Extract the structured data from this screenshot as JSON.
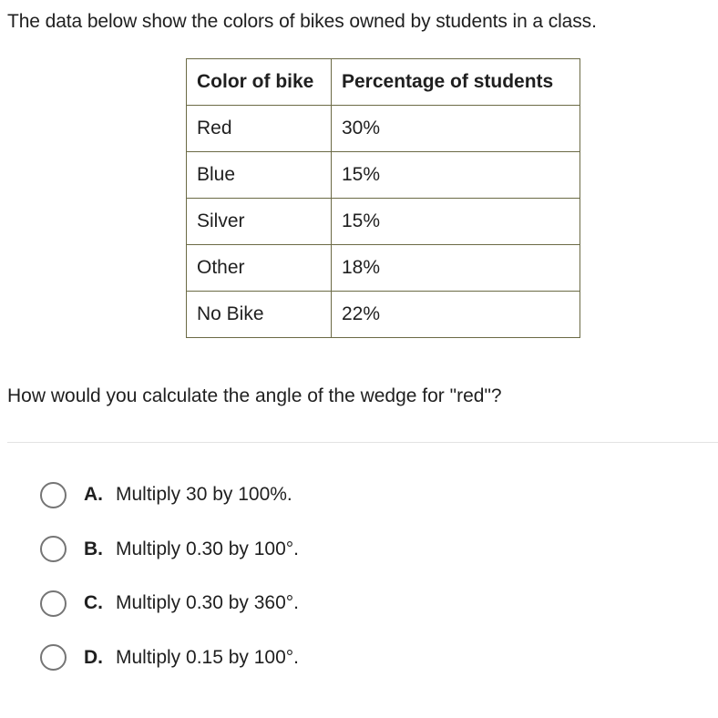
{
  "intro_text": "The data below show the colors of bikes owned by students in a class.",
  "table": {
    "headers": [
      "Color of bike",
      "Percentage of students"
    ],
    "rows": [
      [
        "Red",
        "30%"
      ],
      [
        "Blue",
        "15%"
      ],
      [
        "Silver",
        "15%"
      ],
      [
        "Other",
        "18%"
      ],
      [
        "No Bike",
        "22%"
      ]
    ],
    "border_color": "#6b6a45"
  },
  "question_text": "How would you calculate the angle of the wedge for \"red\"?",
  "options": [
    {
      "letter": "A.",
      "text": "Multiply 30 by 100%.",
      "selected": false
    },
    {
      "letter": "B.",
      "text": "Multiply 0.30 by 100°.",
      "selected": false
    },
    {
      "letter": "C.",
      "text": "Multiply 0.30 by 360°.",
      "selected": false
    },
    {
      "letter": "D.",
      "text": "Multiply 0.15 by 100°.",
      "selected": false
    }
  ],
  "radio_icon": "radio-unchecked-icon"
}
